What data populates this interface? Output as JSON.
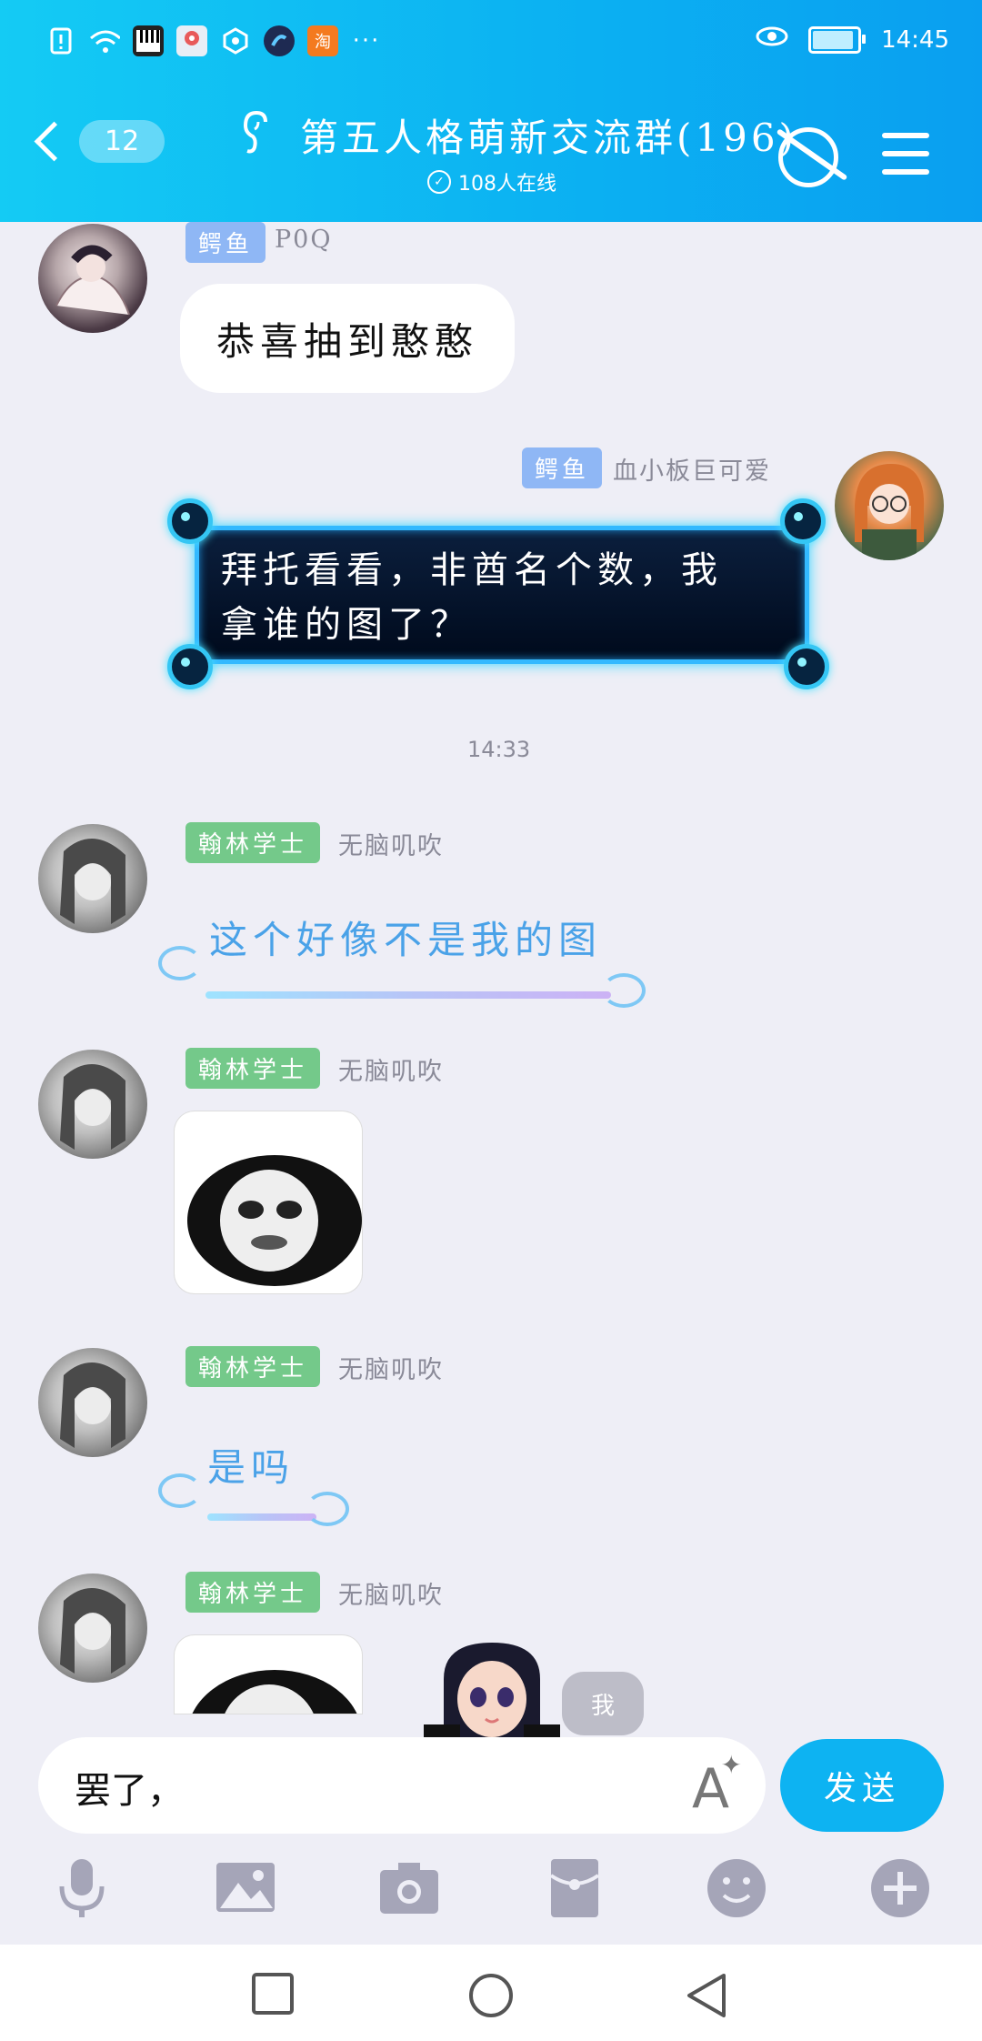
{
  "status_bar": {
    "time": "14:45"
  },
  "header": {
    "back_count": "12",
    "group_title": "第五人格萌新交流群(196)",
    "online_text": "108人在线"
  },
  "messages": [
    {
      "badge": "鳄鱼",
      "nickname": "P0Q",
      "text": "恭喜抽到憨憨"
    },
    {
      "badge": "鳄鱼",
      "nickname": "血小板巨可爱",
      "line1": "拜托看看，非酋名个数，我",
      "line2": "拿谁的图了？"
    },
    {
      "timestamp": "14:33"
    },
    {
      "badge": "翰林学士",
      "nickname": "无脑叽吹",
      "text": "这个好像不是我的图"
    },
    {
      "badge": "翰林学士",
      "nickname": "无脑叽吹",
      "sticker": "panda-face-sticker"
    },
    {
      "badge": "翰林学士",
      "nickname": "无脑叽吹",
      "text": "是吗"
    },
    {
      "badge": "翰林学士",
      "nickname": "无脑叽吹",
      "sticker": "panda-face-sticker"
    }
  ],
  "floating": {
    "bubble_label": "我"
  },
  "input": {
    "value": "罢了，",
    "send_label": "发送"
  },
  "colors": {
    "header": "#0bb0f2",
    "send": "#0db3f2",
    "badge_blue": "#8fb7f5",
    "badge_green": "#74c98a",
    "chat_bg": "#eeeef6"
  },
  "toolbar_icons": [
    "microphone-icon",
    "image-icon",
    "camera-icon",
    "red-packet-icon",
    "emoji-icon",
    "plus-icon"
  ],
  "nav_icons": [
    "recent-apps-icon",
    "home-icon",
    "back-icon"
  ]
}
